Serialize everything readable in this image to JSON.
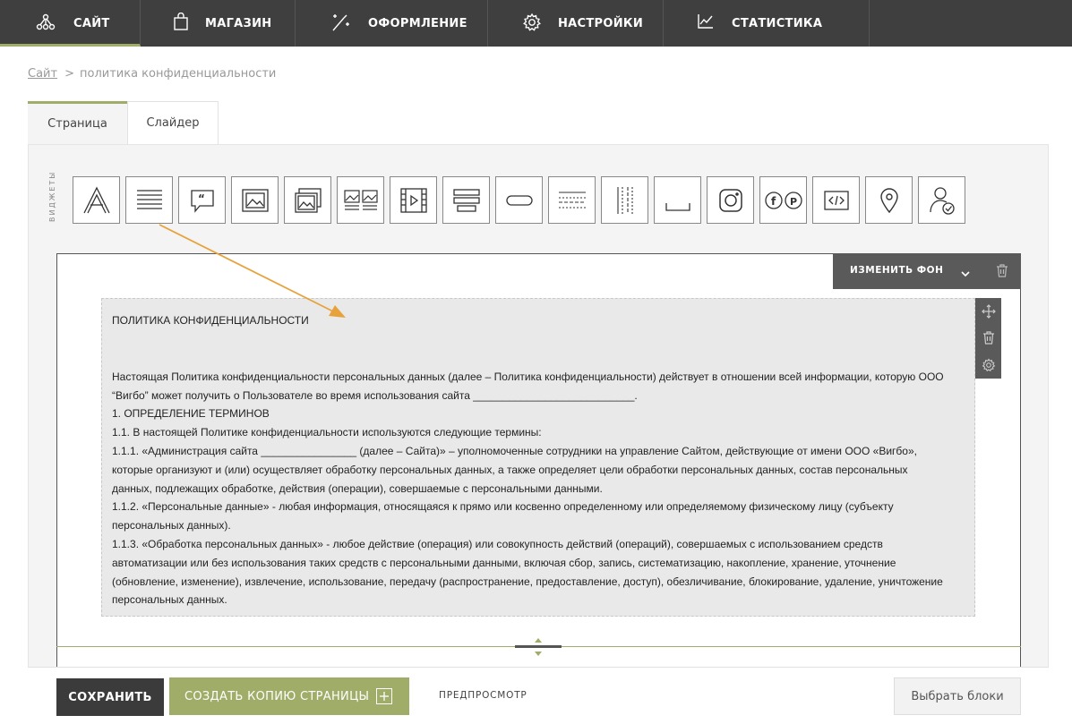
{
  "nav": {
    "items": [
      {
        "label": "САЙТ",
        "icon": "nodes-icon",
        "active": true
      },
      {
        "label": "МАГАЗИН",
        "icon": "shopping-bag-icon"
      },
      {
        "label": "ОФОРМЛЕНИЕ",
        "icon": "magic-wand-icon"
      },
      {
        "label": "НАСТРОЙКИ",
        "icon": "gear-icon"
      },
      {
        "label": "СТАТИСТИКА",
        "icon": "line-chart-icon"
      }
    ]
  },
  "breadcrumb": {
    "link": "Сайт",
    "separator": ">",
    "current": "политика конфиденциальности"
  },
  "tabs": [
    {
      "label": "Страница",
      "active": true
    },
    {
      "label": "Слайдер",
      "active": false
    }
  ],
  "widgets": {
    "label": "ВИДЖЕТЫ",
    "items": [
      "text-icon",
      "paragraph-icon",
      "quote-icon",
      "image-icon",
      "gallery-icon",
      "image-text-icon",
      "video-icon",
      "columns-icon",
      "button-icon",
      "divider-icon",
      "vertical-divider-icon",
      "spacer-icon",
      "instagram-icon",
      "social-icon",
      "code-icon",
      "map-pin-icon",
      "user-check-icon"
    ]
  },
  "section": {
    "bg_button": "ИЗМЕНИТЬ ФОН"
  },
  "text_block": {
    "title": "ПОЛИТИКА КОНФИДЕНЦИАЛЬНОСТИ",
    "lines": [
      "Настоящая Политика конфиденциальности персональных данных (далее – Политика конфиденциальности) действует в отношении всей информации, которую ООО",
      "“Вигбо” может получить о Пользователе во время использования сайта ___________________________.",
      "1. ОПРЕДЕЛЕНИЕ ТЕРМИНОВ",
      "1.1.    В настоящей Политике конфиденциальности используются следующие термины:",
      "1.1.1.    «Администрация сайта ________________ (далее – Сайта)» – уполномоченные сотрудники на управление Сайтом, действующие от имени ООО «Вигбо»,",
      " которые организуют и (или) осуществляет обработку персональных данных, а также определяет цели обработки персональных данных, состав персональных",
      "данных, подлежащих обработке, действия (операции), совершаемые с персональными данными.",
      "1.1.2. «Персональные данные» - любая информация, относящаяся к прямо или косвенно определенному или определяемому физическому лицу (субъекту",
      "персональных данных).",
      "1.1.3. «Обработка персональных данных» - любое действие (операция) или совокупность действий (операций), совершаемых с использованием средств",
      "автоматизации или без использования таких средств с персональными данными, включая сбор, запись, систематизацию, накопление, хранение, уточнение",
      "(обновление, изменение), извлечение, использование, передачу (распространение, предоставление, доступ), обезличивание, блокирование, удаление, уничтожение",
      "персональных данных."
    ]
  },
  "bottom": {
    "save": "СОХРАНИТЬ",
    "copy": "СОЗДАТЬ КОПИЮ СТРАНИЦЫ",
    "preview": "ПРЕДПРОСМОТР",
    "select_blocks": "Выбрать блоки"
  },
  "colors": {
    "nav_bg": "#3f3f3f",
    "accent": "#a0ad68",
    "dark_button": "#3b3b3b",
    "arrow": "#e8a23c"
  }
}
